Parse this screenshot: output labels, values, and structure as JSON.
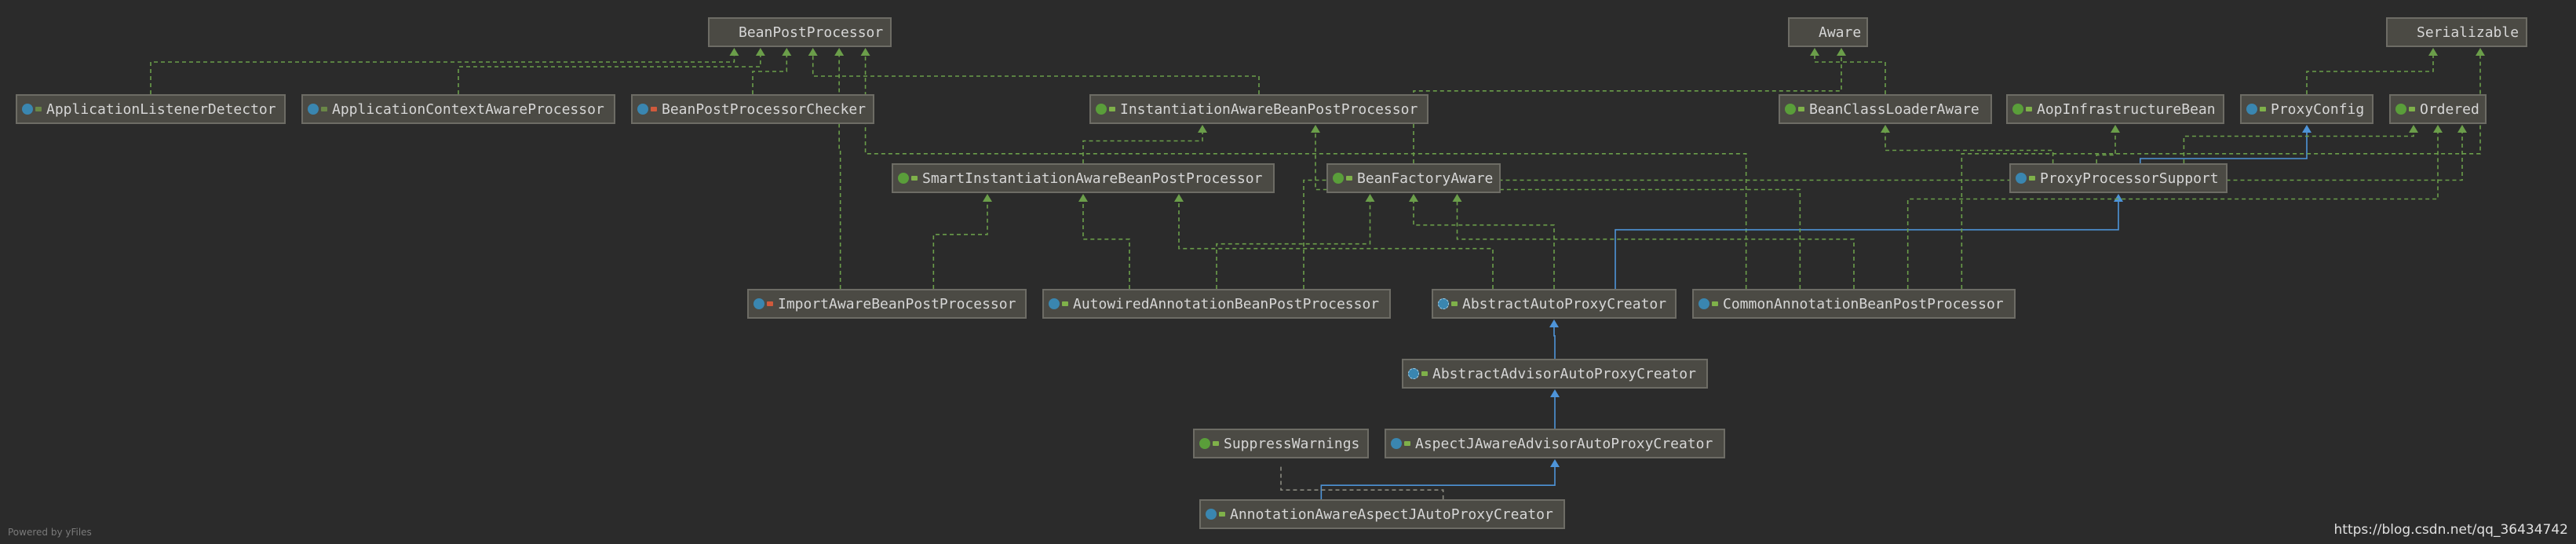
{
  "nodes": {
    "bean_post_processor": {
      "label": "BeanPostProcessor",
      "kind": "interface",
      "modifier": "public"
    },
    "aware": {
      "label": "Aware",
      "kind": "interface",
      "modifier": "public"
    },
    "serializable": {
      "label": "Serializable",
      "kind": "interface",
      "modifier": "public"
    },
    "application_listener_detector": {
      "label": "ApplicationListenerDetector",
      "kind": "class",
      "modifier": "default"
    },
    "application_context_aware_processor": {
      "label": "ApplicationContextAwareProcessor",
      "kind": "class",
      "modifier": "default"
    },
    "bean_post_processor_checker": {
      "label": "BeanPostProcessorChecker",
      "kind": "class",
      "modifier": "private"
    },
    "instantiation_aware_bean_post_processor": {
      "label": "InstantiationAwareBeanPostProcessor",
      "kind": "interface",
      "modifier": "public"
    },
    "bean_class_loader_aware": {
      "label": "BeanClassLoaderAware",
      "kind": "interface",
      "modifier": "public"
    },
    "aop_infrastructure_bean": {
      "label": "AopInfrastructureBean",
      "kind": "interface",
      "modifier": "public"
    },
    "proxy_config": {
      "label": "ProxyConfig",
      "kind": "class",
      "modifier": "public"
    },
    "ordered": {
      "label": "Ordered",
      "kind": "interface",
      "modifier": "public"
    },
    "smart_instantiation_aware_bean_post_processor": {
      "label": "SmartInstantiationAwareBeanPostProcessor",
      "kind": "interface",
      "modifier": "public"
    },
    "bean_factory_aware": {
      "label": "BeanFactoryAware",
      "kind": "interface",
      "modifier": "public"
    },
    "proxy_processor_support": {
      "label": "ProxyProcessorSupport",
      "kind": "class",
      "modifier": "public"
    },
    "import_aware_bean_post_processor": {
      "label": "ImportAwareBeanPostProcessor",
      "kind": "class",
      "modifier": "private"
    },
    "autowired_annotation_bean_post_processor": {
      "label": "AutowiredAnnotationBeanPostProcessor",
      "kind": "class",
      "modifier": "public"
    },
    "abstract_auto_proxy_creator": {
      "label": "AbstractAutoProxyCreator",
      "kind": "abstract",
      "modifier": "public"
    },
    "common_annotation_bean_post_processor": {
      "label": "CommonAnnotationBeanPostProcessor",
      "kind": "class",
      "modifier": "public"
    },
    "abstract_advisor_auto_proxy_creator": {
      "label": "AbstractAdvisorAutoProxyCreator",
      "kind": "abstract",
      "modifier": "public"
    },
    "suppress_warnings": {
      "label": "SuppressWarnings",
      "kind": "interface",
      "modifier": "public"
    },
    "aspectj_aware_advisor_auto_proxy_creator": {
      "label": "AspectJAwareAdvisorAutoProxyCreator",
      "kind": "class",
      "modifier": "public"
    },
    "annotation_aware_aspectj_auto_proxy_creator": {
      "label": "AnnotationAwareAspectJAutoProxyCreator",
      "kind": "class",
      "modifier": "public"
    }
  },
  "edges": [
    {
      "from": "application_listener_detector",
      "to": "bean_post_processor",
      "type": "implements"
    },
    {
      "from": "application_context_aware_processor",
      "to": "bean_post_processor",
      "type": "implements"
    },
    {
      "from": "bean_post_processor_checker",
      "to": "bean_post_processor",
      "type": "implements"
    },
    {
      "from": "instantiation_aware_bean_post_processor",
      "to": "bean_post_processor",
      "type": "implements"
    },
    {
      "from": "import_aware_bean_post_processor",
      "to": "bean_post_processor",
      "type": "implements"
    },
    {
      "from": "common_annotation_bean_post_processor",
      "to": "bean_post_processor",
      "type": "implements"
    },
    {
      "from": "bean_class_loader_aware",
      "to": "aware",
      "type": "implements"
    },
    {
      "from": "bean_factory_aware",
      "to": "aware",
      "type": "implements"
    },
    {
      "from": "proxy_config",
      "to": "serializable",
      "type": "implements"
    },
    {
      "from": "proxy_processor_support",
      "to": "bean_class_loader_aware",
      "type": "implements"
    },
    {
      "from": "proxy_processor_support",
      "to": "aop_infrastructure_bean",
      "type": "implements"
    },
    {
      "from": "proxy_processor_support",
      "to": "proxy_config",
      "type": "extends"
    },
    {
      "from": "proxy_processor_support",
      "to": "ordered",
      "type": "implements"
    },
    {
      "from": "smart_instantiation_aware_bean_post_processor",
      "to": "instantiation_aware_bean_post_processor",
      "type": "implements"
    },
    {
      "from": "import_aware_bean_post_processor",
      "to": "smart_instantiation_aware_bean_post_processor",
      "type": "implements"
    },
    {
      "from": "autowired_annotation_bean_post_processor",
      "to": "smart_instantiation_aware_bean_post_processor",
      "type": "implements"
    },
    {
      "from": "autowired_annotation_bean_post_processor",
      "to": "bean_factory_aware",
      "type": "implements"
    },
    {
      "from": "abstract_auto_proxy_creator",
      "to": "smart_instantiation_aware_bean_post_processor",
      "type": "implements"
    },
    {
      "from": "abstract_auto_proxy_creator",
      "to": "bean_factory_aware",
      "type": "implements"
    },
    {
      "from": "abstract_auto_proxy_creator",
      "to": "proxy_processor_support",
      "type": "extends"
    },
    {
      "from": "common_annotation_bean_post_processor",
      "to": "instantiation_aware_bean_post_processor",
      "type": "implements"
    },
    {
      "from": "common_annotation_bean_post_processor",
      "to": "bean_factory_aware",
      "type": "implements"
    },
    {
      "from": "common_annotation_bean_post_processor",
      "to": "ordered",
      "type": "implements"
    },
    {
      "from": "common_annotation_bean_post_processor",
      "to": "serializable",
      "type": "implements"
    },
    {
      "from": "autowired_annotation_bean_post_processor",
      "to": "ordered",
      "type": "implements"
    },
    {
      "from": "abstract_advisor_auto_proxy_creator",
      "to": "abstract_auto_proxy_creator",
      "type": "extends"
    },
    {
      "from": "aspectj_aware_advisor_auto_proxy_creator",
      "to": "abstract_advisor_auto_proxy_creator",
      "type": "extends"
    },
    {
      "from": "annotation_aware_aspectj_auto_proxy_creator",
      "to": "aspectj_aware_advisor_auto_proxy_creator",
      "type": "extends"
    },
    {
      "from": "annotation_aware_aspectj_auto_proxy_creator",
      "to": "suppress_warnings",
      "type": "annotated"
    }
  ],
  "colors": {
    "background": "#2b2b2b",
    "implements_edge": "#6b9e4a",
    "extends_edge": "#4e94d8",
    "node_fill": "#4b4a44",
    "node_border": "#6d6c65"
  },
  "footer": {
    "powered_by": "Powered by yFiles",
    "watermark": "https://blog.csdn.net/qq_36434742"
  }
}
